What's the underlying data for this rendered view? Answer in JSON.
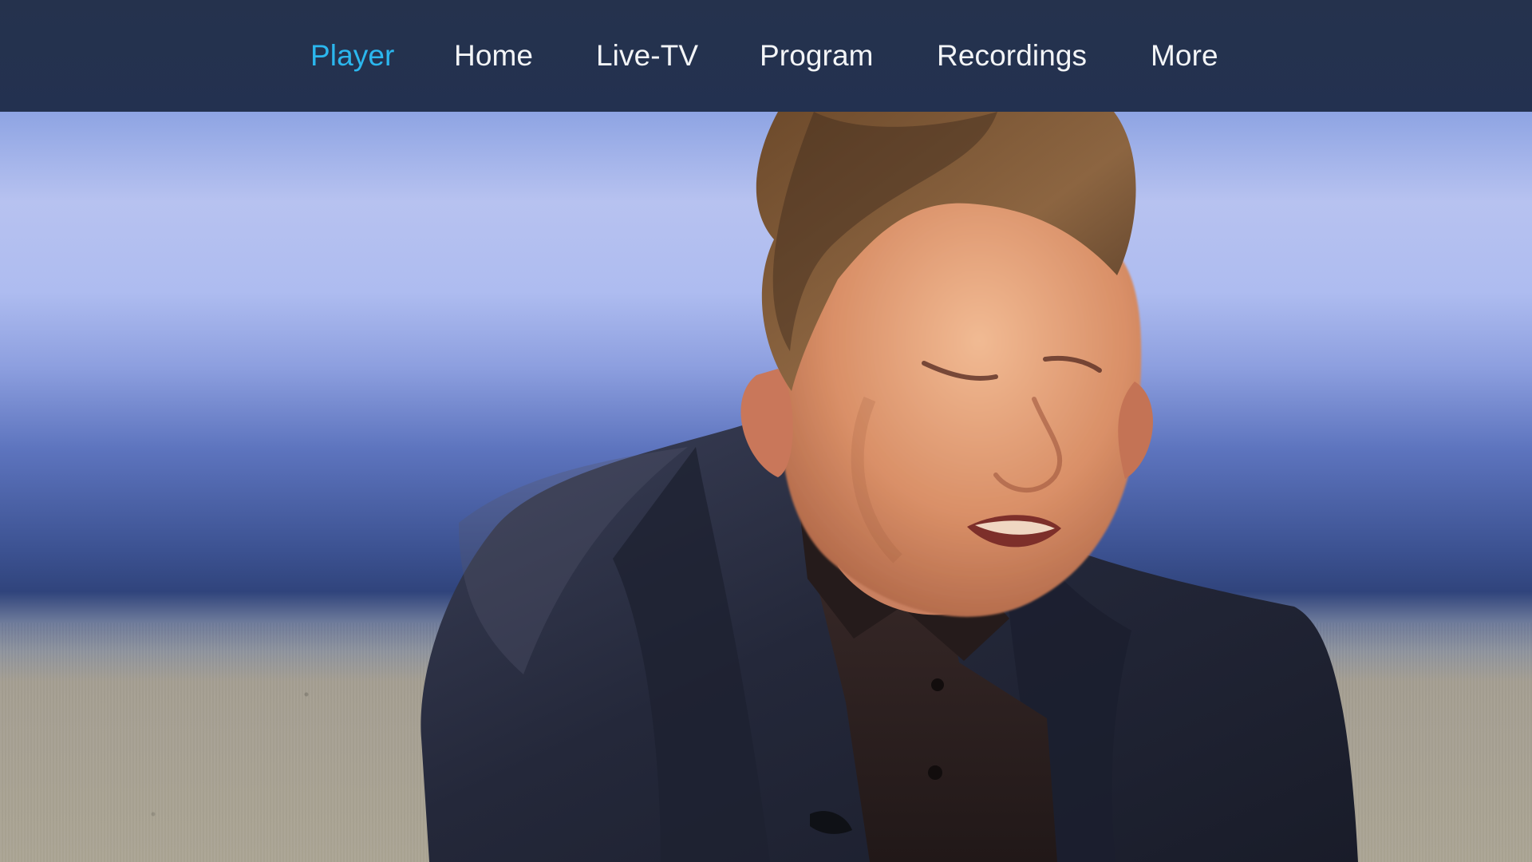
{
  "navigation": {
    "tabs": [
      {
        "label": "Player",
        "active": true
      },
      {
        "label": "Home",
        "active": false
      },
      {
        "label": "Live-TV",
        "active": false
      },
      {
        "label": "Program",
        "active": false
      },
      {
        "label": "Recordings",
        "active": false
      },
      {
        "label": "More",
        "active": false
      }
    ]
  },
  "colors": {
    "topbar": "#25324d",
    "active_tab": "#2bb7ee",
    "inactive_tab": "#f3f5f7",
    "video_background": "#8ea4e3"
  }
}
